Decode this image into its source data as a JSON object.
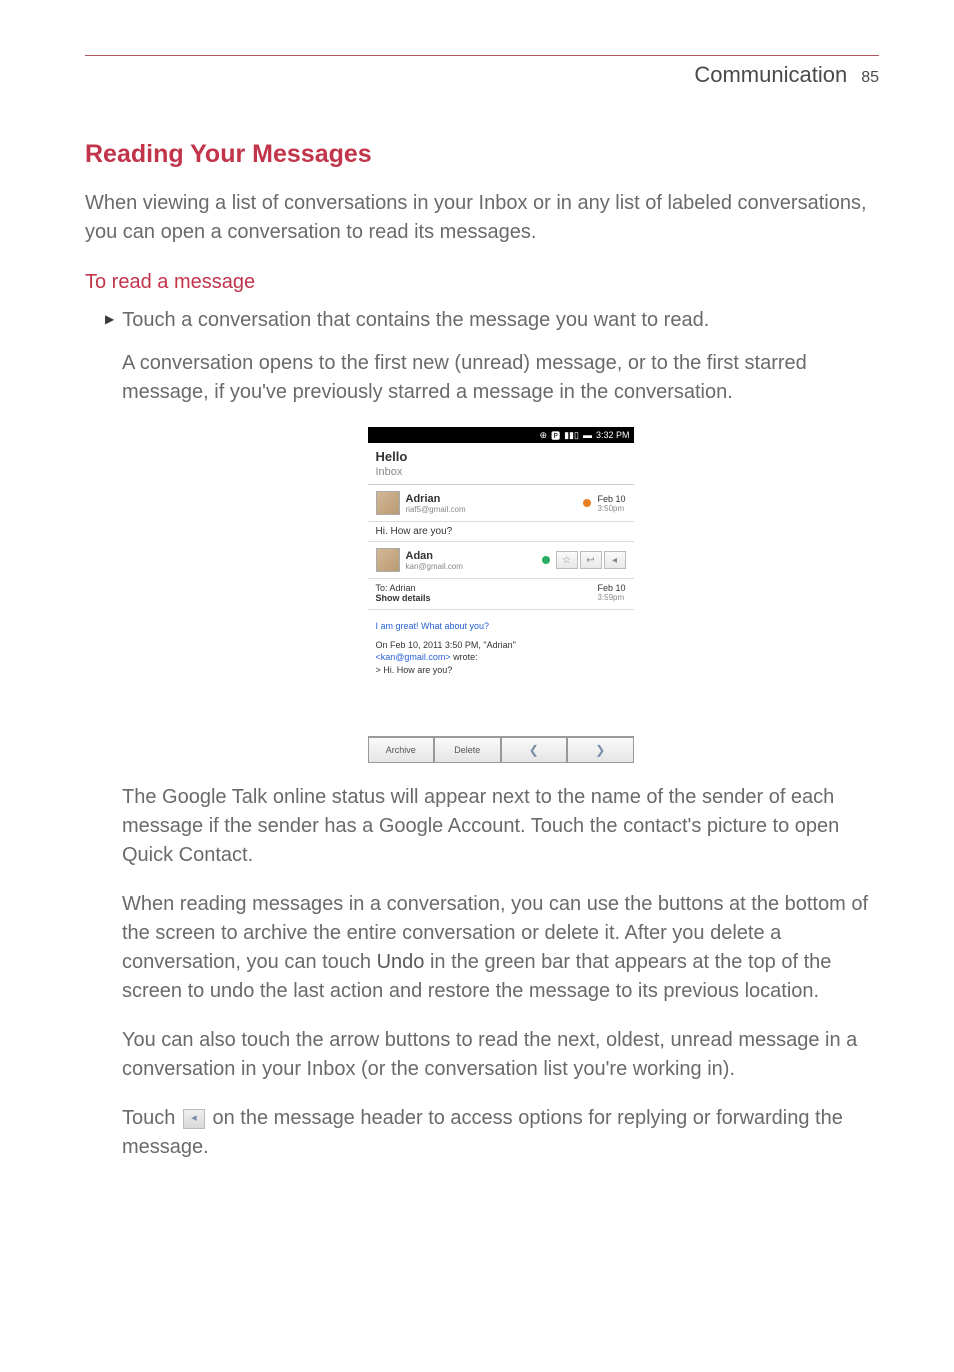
{
  "header": {
    "title": "Communication",
    "page": "85"
  },
  "section_heading": "Reading Your Messages",
  "intro": "When viewing a list of conversations in your Inbox or in any list of labeled conversations, you can open a conversation to read its messages.",
  "subheading": "To read a message",
  "bullet1": "Touch a conversation that contains the message you want to read.",
  "para1": "A conversation opens to the first new (unread) message, or to the first starred message, if you've previously starred a message in the conversation.",
  "screenshot": {
    "status_time": "3:32 PM",
    "hello": "Hello",
    "inbox": "Inbox",
    "sender1": "Adrian",
    "email1": "riaf5@gmail.com",
    "date1": "Feb 10",
    "time1": "3:50pm",
    "subject1": "Hi. How are you?",
    "sender2": "Adan",
    "email2": "kan@gmail.com",
    "to_label": "To:",
    "to_name": "Adrian",
    "show_details": "Show details",
    "date2": "Feb 10",
    "time2": "3:59pm",
    "body_line1": "I am great! What about you?",
    "body_line2": "On Feb 10, 2011 3:50 PM, \"Adrian\"",
    "body_email": "<kan@gmail.com>",
    "body_wrote": " wrote:",
    "body_line4": "> Hi. How are you?",
    "btn_archive": "Archive",
    "btn_delete": "Delete"
  },
  "para2": "The Google Talk online status will appear next to the name of the sender of each message if the sender has a Google Account. Touch the contact's picture to open Quick Contact.",
  "para3a": "When reading messages in a conversation, you can use the buttons at the bottom of the screen to archive the entire conversation or delete it. After you delete a conversation, you can touch ",
  "para3_undo": "Undo",
  "para3b": " in the green bar that appears at the top of the screen to undo the last action and restore the message to its previous location.",
  "para4": "You can also touch the arrow buttons to read the next, oldest, unread message in a conversation in your Inbox (or the conversation list you're working in).",
  "para5a": "Touch ",
  "para5b": " on the message header to access options for replying or forwarding the message."
}
